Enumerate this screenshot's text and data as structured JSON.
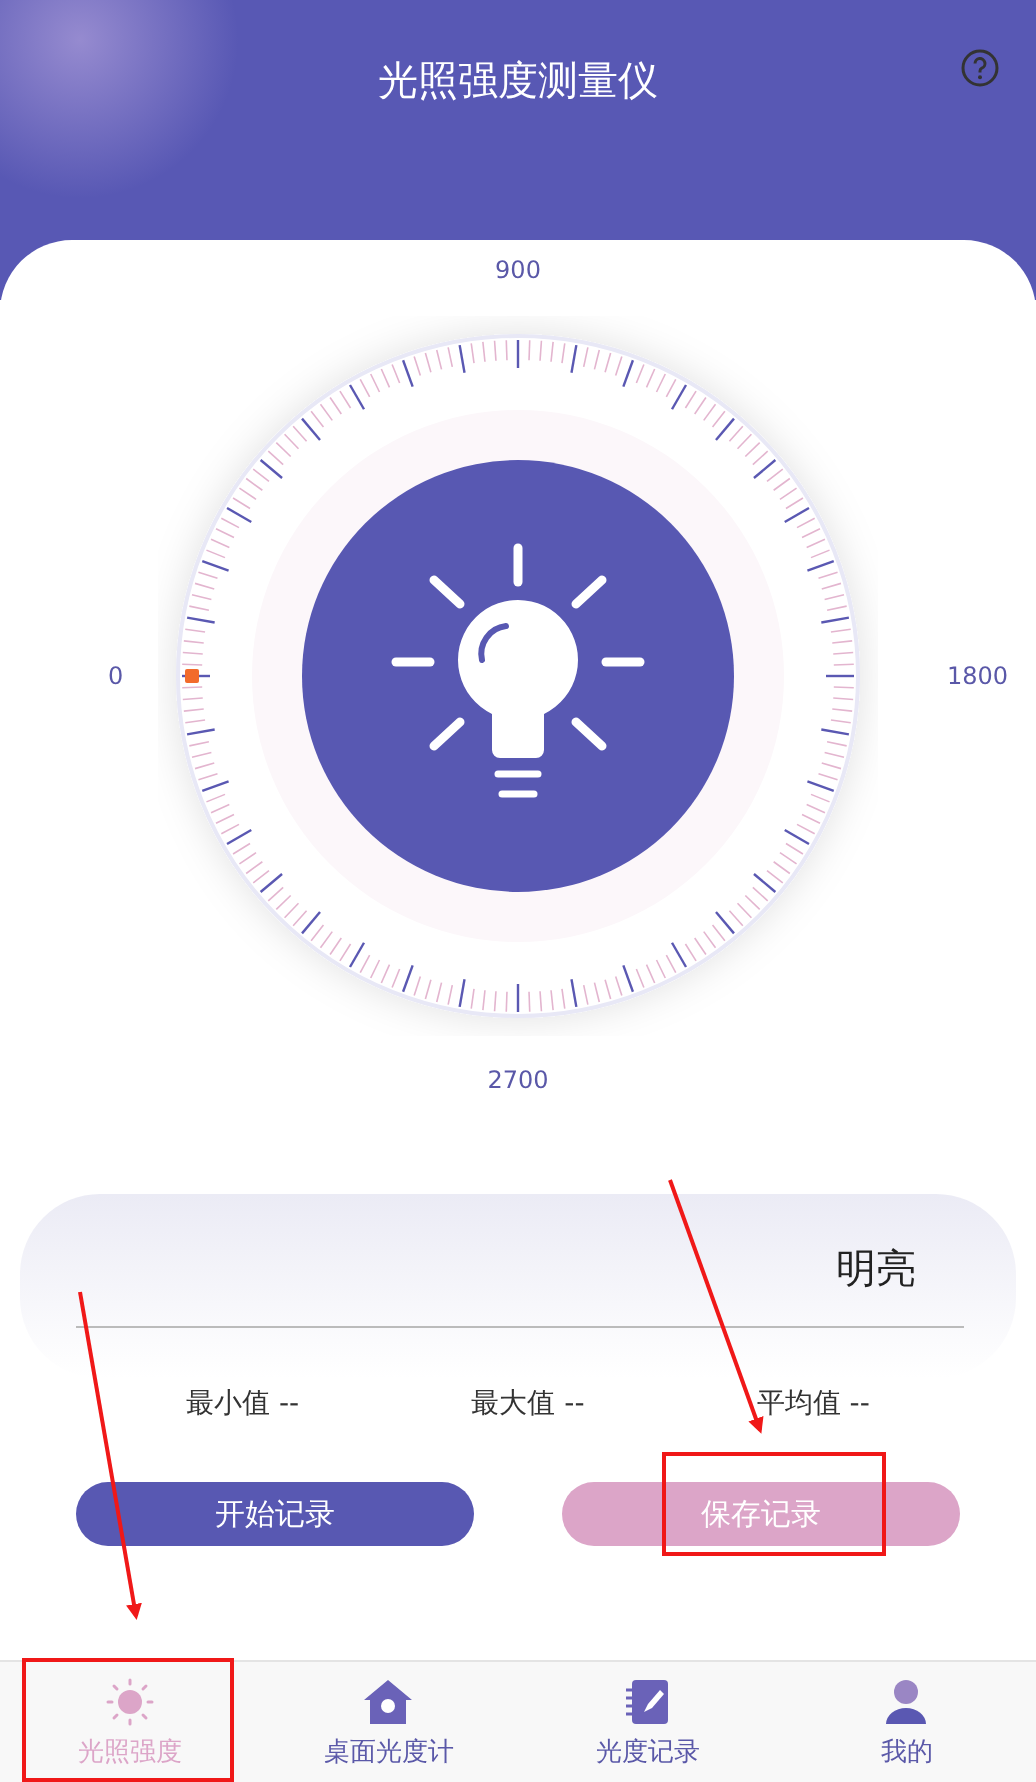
{
  "header": {
    "title": "光照强度测量仪"
  },
  "gauge": {
    "labels": [
      "900",
      "1800",
      "2700",
      "0"
    ],
    "level": 0
  },
  "status": {
    "text": "明亮"
  },
  "stats": [
    {
      "label": "最小值",
      "value": "--"
    },
    {
      "label": "最大值",
      "value": "--"
    },
    {
      "label": "平均值",
      "value": "--"
    }
  ],
  "buttons": [
    {
      "label": "开始记录",
      "kind": "primary"
    },
    {
      "label": "保存记录",
      "kind": "secondary"
    }
  ],
  "nav": [
    {
      "label": "光照强度",
      "selected": true
    },
    {
      "label": "桌面光度计",
      "selected": false
    },
    {
      "label": "光度记录",
      "selected": false
    },
    {
      "label": "我的",
      "selected": false
    }
  ]
}
